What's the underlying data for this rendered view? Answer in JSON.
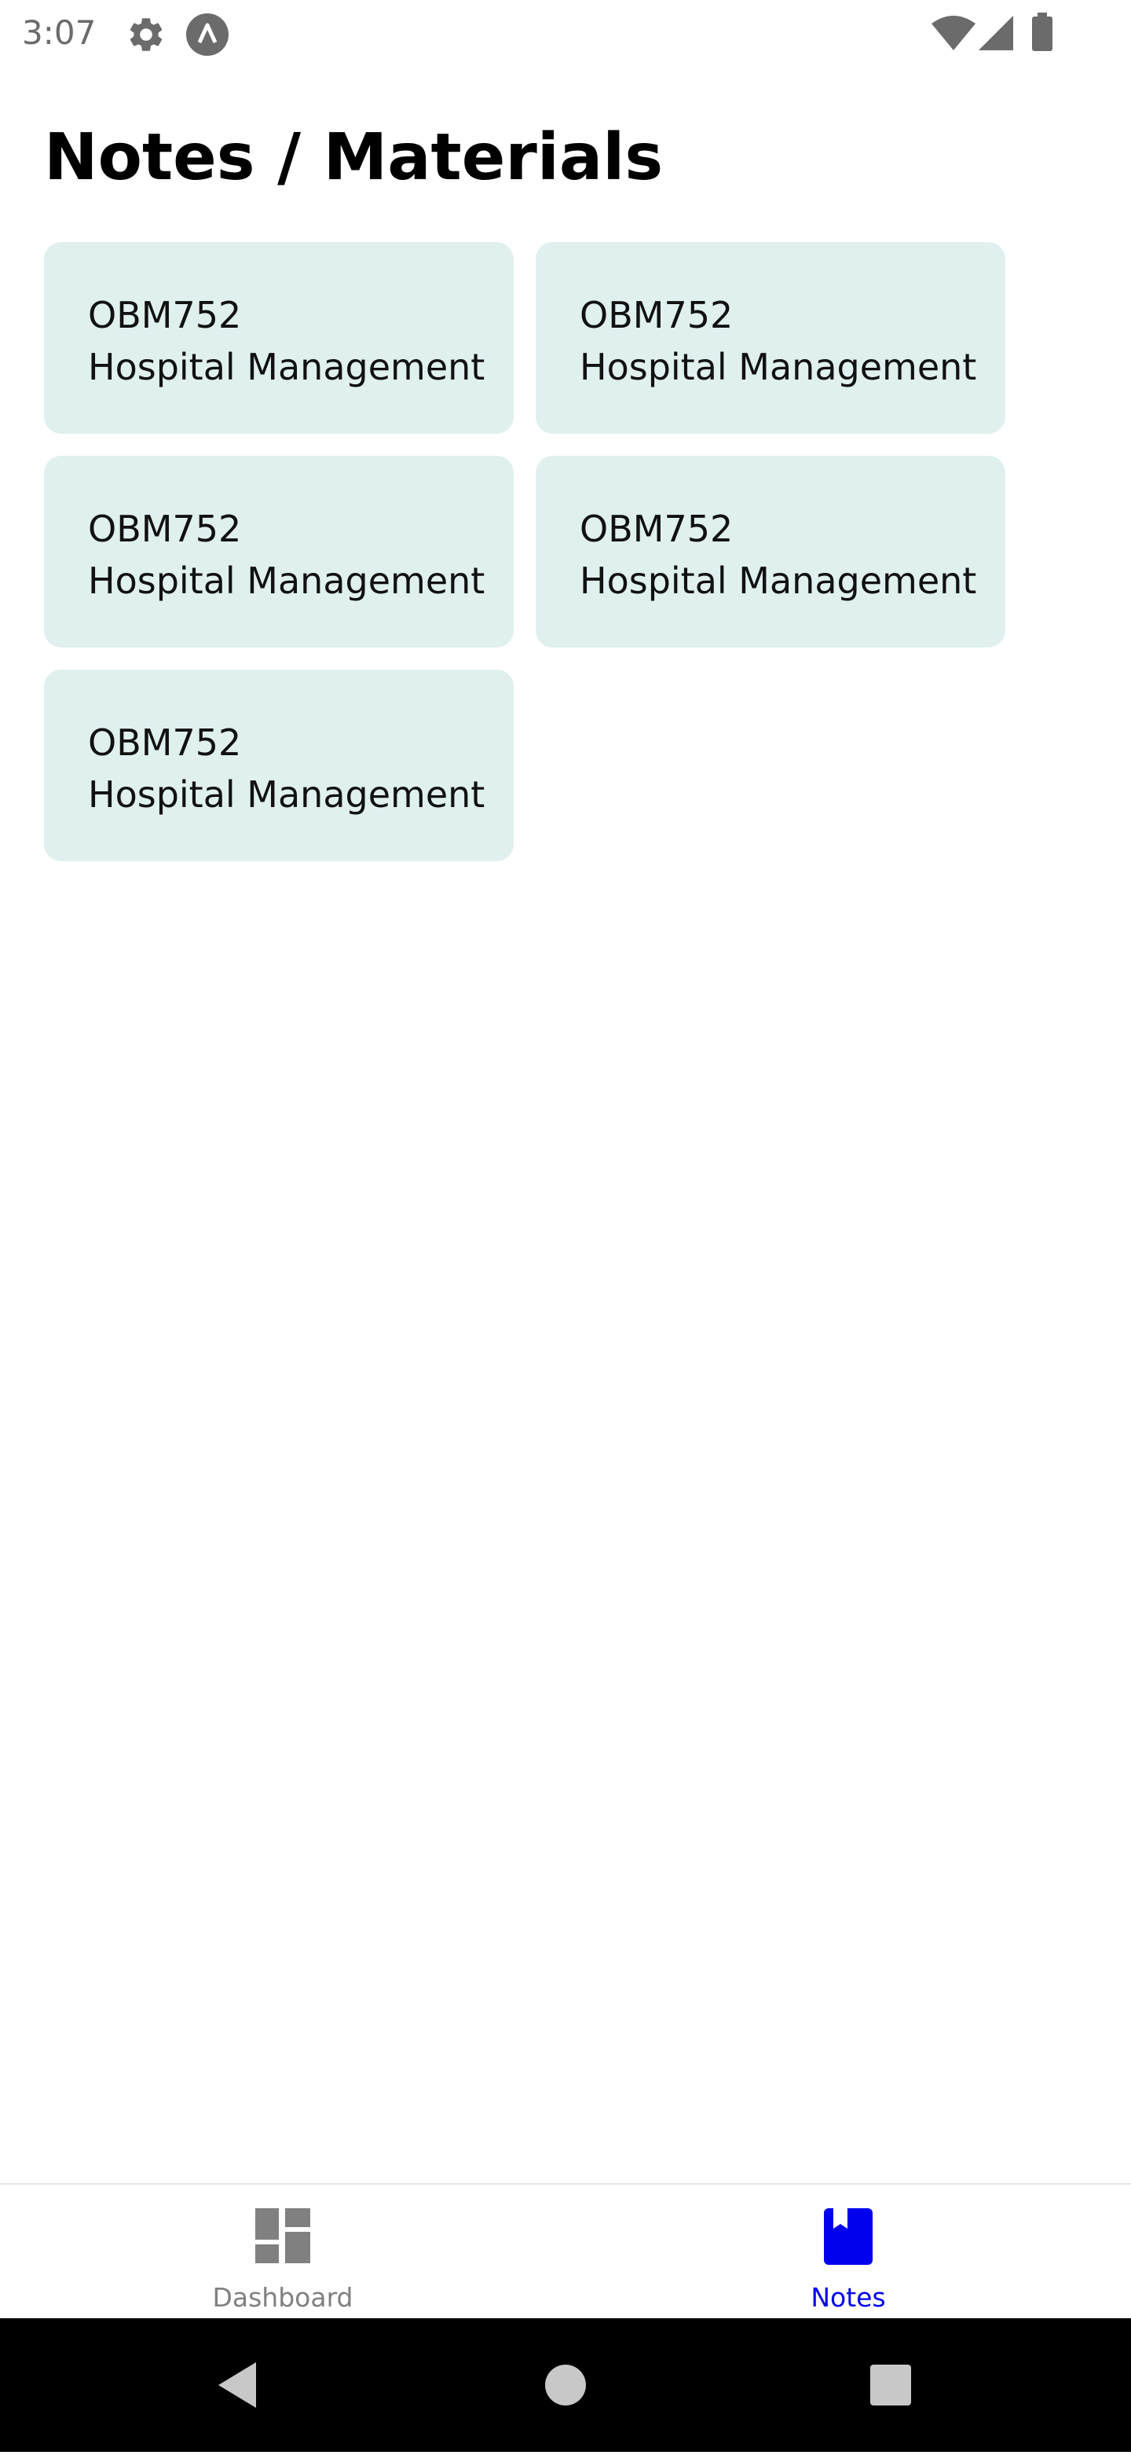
{
  "status_bar": {
    "time": "3:07",
    "icons": [
      "gear-icon",
      "app-a-icon",
      "wifi-icon",
      "signal-icon",
      "battery-icon"
    ]
  },
  "page": {
    "title": "Notes / Materials"
  },
  "cards": [
    {
      "code": "OBM752",
      "name": "Hospital Management"
    },
    {
      "code": "OBM752",
      "name": "Hospital Management"
    },
    {
      "code": "OBM752",
      "name": "Hospital Management"
    },
    {
      "code": "OBM752",
      "name": "Hospital Management"
    },
    {
      "code": "OBM752",
      "name": "Hospital Management"
    }
  ],
  "bottom_nav": {
    "items": [
      {
        "label": "Dashboard",
        "icon": "dashboard-icon",
        "active": false
      },
      {
        "label": "Notes",
        "icon": "notes-icon",
        "active": true
      }
    ],
    "active_color": "#0000ee",
    "inactive_color": "#808080"
  },
  "colors": {
    "card_background": "#dff0ef",
    "system_nav_background": "#000000"
  },
  "system_nav": {
    "buttons": [
      "back-icon",
      "home-icon",
      "recents-icon"
    ]
  }
}
